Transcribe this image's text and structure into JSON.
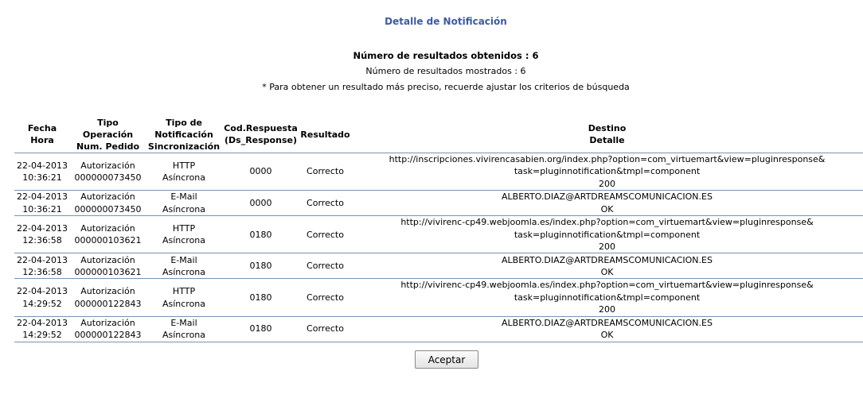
{
  "title": "Detalle de Notificación",
  "results_obtained": "Número de resultados obtenidos : 6",
  "results_shown": "Número de resultados mostrados : 6",
  "hint": "* Para obtener un resultado más preciso, recuerde ajustar los criterios de búsqueda",
  "headers": {
    "fecha": [
      "Fecha",
      "Hora"
    ],
    "tipo_op": [
      "Tipo",
      "Operación",
      "Num. Pedido"
    ],
    "tipo_notif": [
      "Tipo de",
      "Notificación",
      "Sincronización"
    ],
    "cod": [
      "Cod.Respuesta",
      "(Ds_Response)"
    ],
    "resultado": "Resultado",
    "destino": [
      "Destino",
      "Detalle"
    ]
  },
  "rows": [
    {
      "date": "22-04-2013",
      "time": "10:36:21",
      "op": "Autorización",
      "order": "000000073450",
      "notif": "HTTP",
      "sync": "Asíncrona",
      "code": "0000",
      "result": "Correcto",
      "dest": [
        "http://inscripciones.vivirencasabien.org/index.php?option=com_virtuemart&view=pluginresponse&",
        "task=pluginnotification&tmpl=component",
        "200"
      ]
    },
    {
      "date": "22-04-2013",
      "time": "10:36:21",
      "op": "Autorización",
      "order": "000000073450",
      "notif": "E-Mail",
      "sync": "Asíncrona",
      "code": "0000",
      "result": "Correcto",
      "dest": [
        "ALBERTO.DIAZ@ARTDREAMSCOMUNICACION.ES",
        "OK"
      ]
    },
    {
      "date": "22-04-2013",
      "time": "12:36:58",
      "op": "Autorización",
      "order": "000000103621",
      "notif": "HTTP",
      "sync": "Asíncrona",
      "code": "0180",
      "result": "Correcto",
      "dest": [
        "http://vivirenc-cp49.webjoomla.es/index.php?option=com_virtuemart&view=pluginresponse&",
        "task=pluginnotification&tmpl=component",
        "200"
      ]
    },
    {
      "date": "22-04-2013",
      "time": "12:36:58",
      "op": "Autorización",
      "order": "000000103621",
      "notif": "E-Mail",
      "sync": "Asíncrona",
      "code": "0180",
      "result": "Correcto",
      "dest": [
        "ALBERTO.DIAZ@ARTDREAMSCOMUNICACION.ES",
        "OK"
      ]
    },
    {
      "date": "22-04-2013",
      "time": "14:29:52",
      "op": "Autorización",
      "order": "000000122843",
      "notif": "HTTP",
      "sync": "Asíncrona",
      "code": "0180",
      "result": "Correcto",
      "dest": [
        "http://vivirenc-cp49.webjoomla.es/index.php?option=com_virtuemart&view=pluginresponse&",
        "task=pluginnotification&tmpl=component",
        "200"
      ]
    },
    {
      "date": "22-04-2013",
      "time": "14:29:52",
      "op": "Autorización",
      "order": "000000122843",
      "notif": "E-Mail",
      "sync": "Asíncrona",
      "code": "0180",
      "result": "Correcto",
      "dest": [
        "ALBERTO.DIAZ@ARTDREAMSCOMUNICACION.ES",
        "OK"
      ]
    }
  ],
  "accept_button": "Aceptar"
}
